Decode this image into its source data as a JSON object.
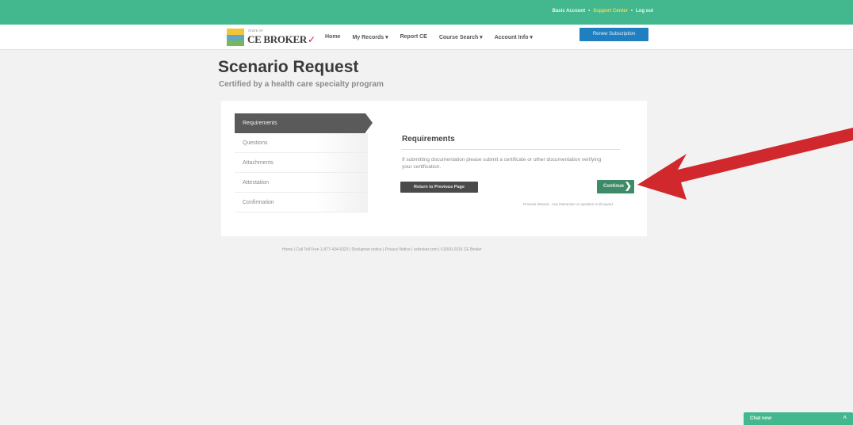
{
  "topbar": {
    "links": [
      "Basic Account",
      "Support Center",
      "Log out"
    ],
    "separator": "•",
    "color": "#43b88e"
  },
  "logo": {
    "small_text": "STATE OF",
    "name": "CE BROKER",
    "icon": "ce-broker-logo-icon"
  },
  "nav": {
    "items": [
      "Home",
      "My Records ▾",
      "Report CE",
      "Course Search ▾",
      "Account Info ▾"
    ],
    "renew_button": "Renew Subscription"
  },
  "page": {
    "title": "Scenario Request",
    "subtitle": "Certified by a health care specialty program"
  },
  "steps": [
    "Requirements",
    "Questions",
    "Attachments",
    "Attestation",
    "Confirmation"
  ],
  "requirements": {
    "title": "Requirements",
    "text": "If submitting documentation please submit a certificate or other documentation verifying your certification.",
    "return_button": "Return to Previous Page",
    "continue_button": "Continue",
    "continue_icon": "chevron-right-icon",
    "note": "Process timeout · Any interaction or question is all saved"
  },
  "footer": "Home | Call Toll Free 1-877-434-6323 | Disclaimer notice | Privacy Notice | cebroker.com | ©2000-2016 CE Broker",
  "annotation": {
    "icon": "red-arrow-icon",
    "color": "#d0282d"
  },
  "chat": {
    "label": "Chat now",
    "icon": "chevron-up-icon"
  }
}
